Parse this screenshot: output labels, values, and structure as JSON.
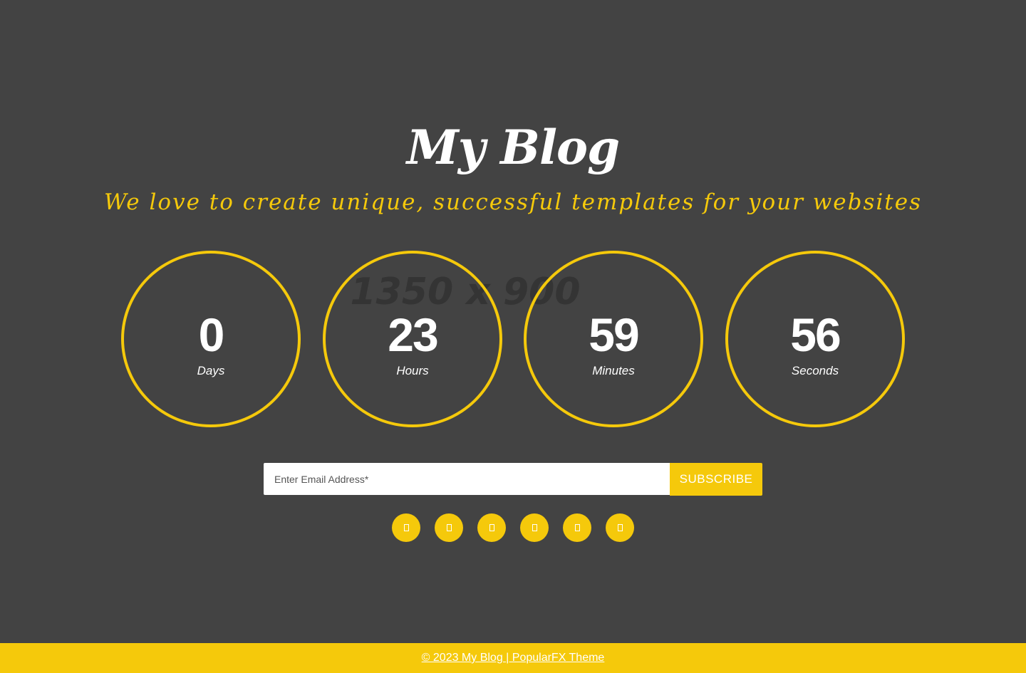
{
  "background": {
    "placeholder_text": "1350 x 900",
    "color": "#434343"
  },
  "header": {
    "title": "My Blog",
    "tagline": "We love to create unique, successful templates for your websites"
  },
  "countdown": [
    {
      "value": "0",
      "unit": "Days"
    },
    {
      "value": "23",
      "unit": "Hours"
    },
    {
      "value": "59",
      "unit": "Minutes"
    },
    {
      "value": "56",
      "unit": "Seconds"
    }
  ],
  "subscribe": {
    "email_placeholder": "Enter Email Address*",
    "email_value": "",
    "button_label": "SUBSCRIBE"
  },
  "social_links": [
    {
      "icon": "facebook-icon"
    },
    {
      "icon": "twitter-icon"
    },
    {
      "icon": "instagram-icon"
    },
    {
      "icon": "linkedin-icon"
    },
    {
      "icon": "youtube-icon"
    },
    {
      "icon": "pinterest-icon"
    }
  ],
  "footer": {
    "text": "© 2023 My Blog | PopularFX Theme"
  },
  "colors": {
    "accent": "#f5c90b",
    "background": "#434343",
    "text": "#ffffff"
  }
}
